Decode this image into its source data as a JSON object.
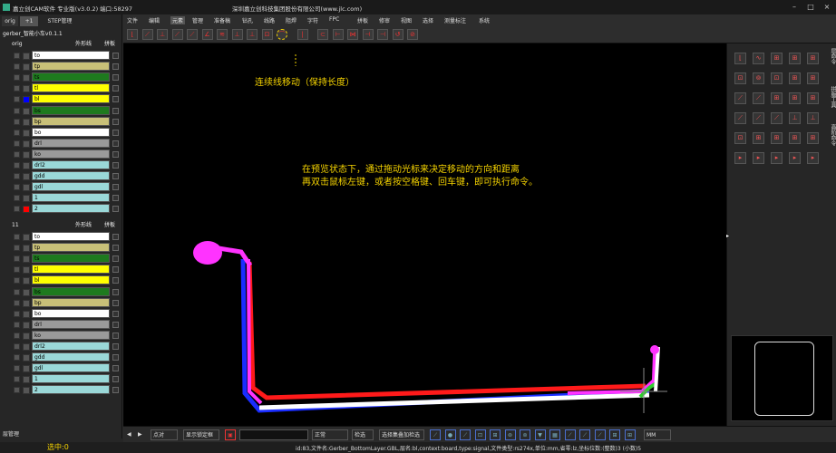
{
  "app": {
    "title": "嘉立创CAM软件 专业版(v3.0.2) 端口:58297",
    "company": "深圳嘉立创科技集团股份有限公司(www.jlc.com)"
  },
  "left_panel": {
    "tabs": [
      "orig",
      "+1",
      "STEP管理"
    ],
    "project": "gerber_智能小车v0.1.1",
    "groups": [
      {
        "name": "orig",
        "outline_label": "外形线",
        "panel_label": "拼板",
        "layers": [
          {
            "name": "to",
            "color": "#ffffff",
            "swatch": "#555555"
          },
          {
            "name": "tp",
            "color": "#c8c078",
            "swatch": "#555555"
          },
          {
            "name": "ts",
            "color": "#1e7a1e",
            "swatch": "#555555"
          },
          {
            "name": "tl",
            "color": "#ffff00",
            "swatch": "#555555"
          },
          {
            "name": "bl",
            "color": "#ffff00",
            "swatch": "#0000ff"
          },
          {
            "name": "bs",
            "color": "#1e7a1e",
            "swatch": "#555555"
          },
          {
            "name": "bp",
            "color": "#c8c078",
            "swatch": "#555555"
          },
          {
            "name": "bo",
            "color": "#ffffff",
            "swatch": "#555555"
          },
          {
            "name": "drl",
            "color": "#9a9a9a",
            "swatch": "#555555"
          },
          {
            "name": "ko",
            "color": "#9a9a9a",
            "swatch": "#555555"
          },
          {
            "name": "drl2",
            "color": "#9ad8d8",
            "swatch": "#555555"
          },
          {
            "name": "gdd",
            "color": "#9ad8d8",
            "swatch": "#555555"
          },
          {
            "name": "gdl",
            "color": "#9ad8d8",
            "swatch": "#555555"
          },
          {
            "name": "1",
            "color": "#9ad8d8",
            "swatch": "#555555"
          },
          {
            "name": "2",
            "color": "#9ad8d8",
            "swatch": "#ff0000"
          }
        ]
      },
      {
        "name": "11",
        "outline_label": "外形线",
        "panel_label": "拼板",
        "layers": [
          {
            "name": "to",
            "color": "#ffffff",
            "swatch": "#555555"
          },
          {
            "name": "tp",
            "color": "#c8c078",
            "swatch": "#555555"
          },
          {
            "name": "ts",
            "color": "#1e7a1e",
            "swatch": "#555555"
          },
          {
            "name": "tl",
            "color": "#ffff00",
            "swatch": "#555555"
          },
          {
            "name": "bl",
            "color": "#ffff00",
            "swatch": "#555555"
          },
          {
            "name": "bs",
            "color": "#1e7a1e",
            "swatch": "#555555"
          },
          {
            "name": "bp",
            "color": "#c8c078",
            "swatch": "#555555"
          },
          {
            "name": "bo",
            "color": "#ffffff",
            "swatch": "#555555"
          },
          {
            "name": "drl",
            "color": "#9a9a9a",
            "swatch": "#555555"
          },
          {
            "name": "ko",
            "color": "#9a9a9a",
            "swatch": "#555555"
          },
          {
            "name": "drl2",
            "color": "#9ad8d8",
            "swatch": "#555555"
          },
          {
            "name": "gdd",
            "color": "#9ad8d8",
            "swatch": "#555555"
          },
          {
            "name": "gdl",
            "color": "#9ad8d8",
            "swatch": "#555555"
          },
          {
            "name": "1",
            "color": "#9ad8d8",
            "swatch": "#555555"
          },
          {
            "name": "2",
            "color": "#9ad8d8",
            "swatch": "#555555"
          }
        ]
      }
    ],
    "layer_mgmt": "层管理",
    "selected_label": "选中:0"
  },
  "menu": [
    "文件",
    "编辑",
    "元素",
    "管理",
    "准备稿",
    "钻孔",
    "线路",
    "阻焊",
    "字符",
    "FPC",
    "拼板",
    "修审",
    "视图",
    "选择",
    "测量标注",
    "系统"
  ],
  "canvas": {
    "annotation1": "连续线移动（保持长度）",
    "annotation2_line1": "在预览状态下，通过拖动光标来决定移动的方向和距离",
    "annotation2_line2": "再双击鼠标左键，或者按空格键、回车键，即可执行命令。"
  },
  "right_panel": {
    "vtabs": [
      "层命令",
      "拼版工具",
      "高阶命令"
    ]
  },
  "bottom": {
    "mode": "点对",
    "preview_label": "显示锁定框",
    "mode2": "正常",
    "select_label": "检选",
    "select_all_label": "选择集叠加检选",
    "unit": "MM"
  },
  "status_text": "id:83,文件名:Gerber_BottomLayer.GBL,层名:bl,context:board,type:signal,文件类型:rs274x,单位:mm,省零:lz,坐标位数:(整数)3 (小数)5"
}
